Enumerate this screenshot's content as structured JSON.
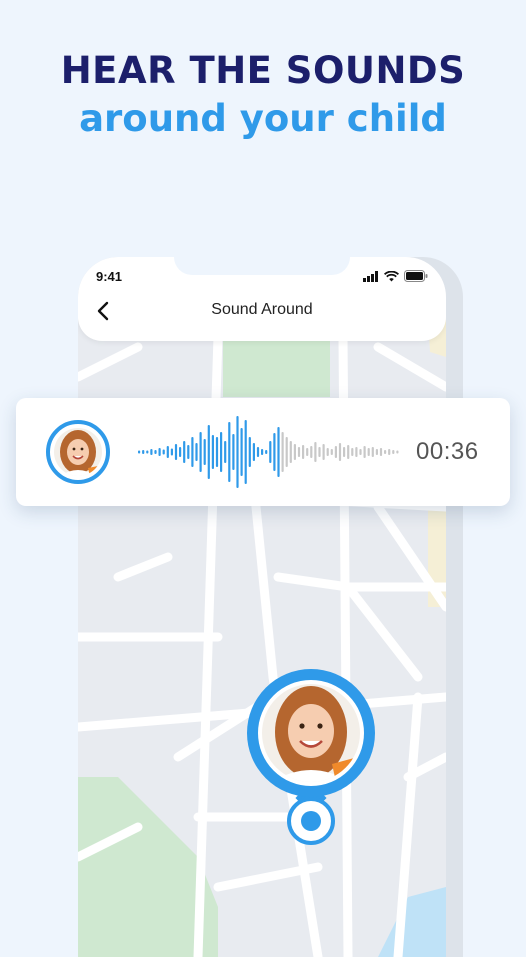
{
  "headline": {
    "line1": "HEAR THE SOUNDS",
    "line2": "around your child"
  },
  "status_bar": {
    "time": "9:41",
    "icons": [
      "signal-icon",
      "wifi-icon",
      "battery-icon"
    ]
  },
  "header": {
    "back_icon": "chevron-left-icon",
    "title": "Sound Around"
  },
  "audio_player": {
    "duration": "00:36",
    "avatar": "child-avatar",
    "played_color": "#2f9ae9",
    "unplayed_color": "#c8c8c8"
  },
  "map": {
    "location_pin": "child-location-pin"
  },
  "colors": {
    "background": "#eef5fd",
    "headline_dark": "#1c1f6b",
    "accent": "#2f9ae9",
    "map_base": "#e8ebf0",
    "park_green": "#cfe8d0"
  }
}
